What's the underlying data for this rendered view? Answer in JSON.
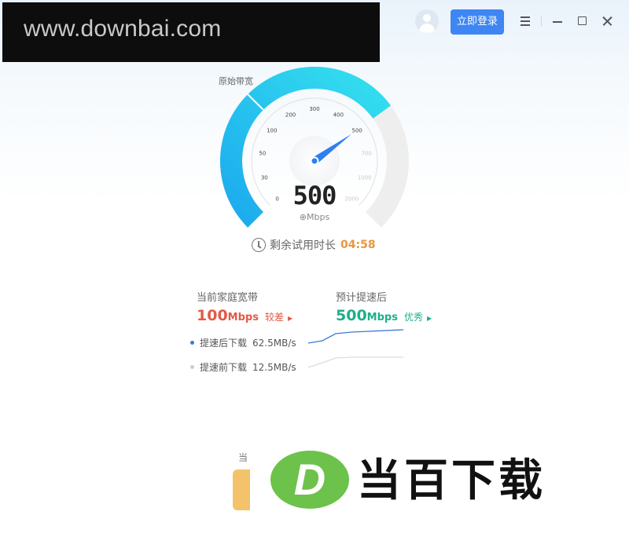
{
  "watermark_top": "www.downbai.com",
  "header": {
    "login_label": "立即登录"
  },
  "gauge": {
    "original_bandwidth_label": "原始带宽",
    "speed_value": "500",
    "speed_unit": "⊕Mbps",
    "value_mbps": 500,
    "scale": [
      "0",
      "30",
      "50",
      "100",
      "200",
      "300",
      "400",
      "500",
      "700",
      "1000",
      "2000"
    ],
    "colors": {
      "arc_start": "#1aa7ee",
      "arc_end": "#36e3ee",
      "arc_rest": "#eeeeee",
      "needle": "#2f7ff0"
    }
  },
  "trial": {
    "label": "剩余试用时长",
    "time": "04:58"
  },
  "comparison": {
    "current": {
      "title": "当前家庭宽带",
      "value": "100",
      "unit": "Mbps",
      "rating": "较差",
      "color": "#e35a46"
    },
    "future": {
      "title": "预计提速后",
      "value": "500",
      "unit": "Mbps",
      "rating": "优秀",
      "color": "#1db08a"
    },
    "after_legend": {
      "label": "提速后下载",
      "value": "62.5MB/s",
      "color": "#3a7bd5"
    },
    "before_legend": {
      "label": "提速前下载",
      "value": "12.5MB/s",
      "color": "#cccccc"
    }
  },
  "bottom": {
    "partial_text": "当"
  },
  "watermark_logo": {
    "letter": "D",
    "text": "当百下载",
    "color": "#6cc24a"
  }
}
